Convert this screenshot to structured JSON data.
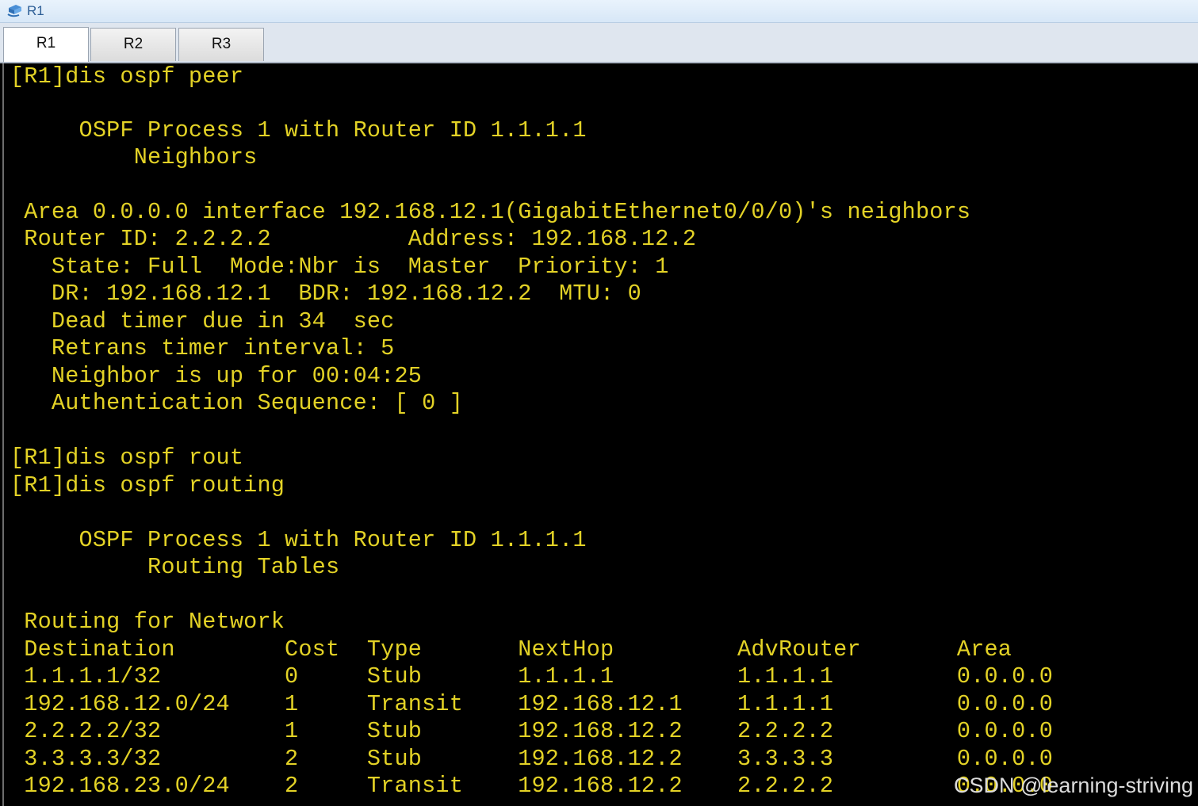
{
  "window": {
    "title": "R1",
    "app_icon": "network-device-icon"
  },
  "tabs": [
    {
      "label": "R1",
      "active": true
    },
    {
      "label": "R2",
      "active": false
    },
    {
      "label": "R3",
      "active": false
    }
  ],
  "terminal": {
    "text_color": "#e3d226",
    "background": "#000000",
    "lines": [
      "[R1]dis ospf peer",
      "",
      "     OSPF Process 1 with Router ID 1.1.1.1",
      "         Neighbors",
      "",
      " Area 0.0.0.0 interface 192.168.12.1(GigabitEthernet0/0/0)'s neighbors",
      " Router ID: 2.2.2.2          Address: 192.168.12.2",
      "   State: Full  Mode:Nbr is  Master  Priority: 1",
      "   DR: 192.168.12.1  BDR: 192.168.12.2  MTU: 0",
      "   Dead timer due in 34  sec",
      "   Retrans timer interval: 5",
      "   Neighbor is up for 00:04:25",
      "   Authentication Sequence: [ 0 ]",
      "",
      "[R1]dis ospf rout",
      "[R1]dis ospf routing",
      "",
      "     OSPF Process 1 with Router ID 1.1.1.1",
      "          Routing Tables",
      "",
      " Routing for Network",
      " Destination        Cost  Type       NextHop         AdvRouter       Area",
      " 1.1.1.1/32         0     Stub       1.1.1.1         1.1.1.1         0.0.0.0",
      " 192.168.12.0/24    1     Transit    192.168.12.1    1.1.1.1         0.0.0.0",
      " 2.2.2.2/32         1     Stub       192.168.12.2    2.2.2.2         0.0.0.0",
      " 3.3.3.3/32         2     Stub       192.168.12.2    3.3.3.3         0.0.0.0",
      " 192.168.23.0/24    2     Transit    192.168.12.2    2.2.2.2         0.0.0.0"
    ]
  },
  "watermark": "CSDN @learning-striving"
}
